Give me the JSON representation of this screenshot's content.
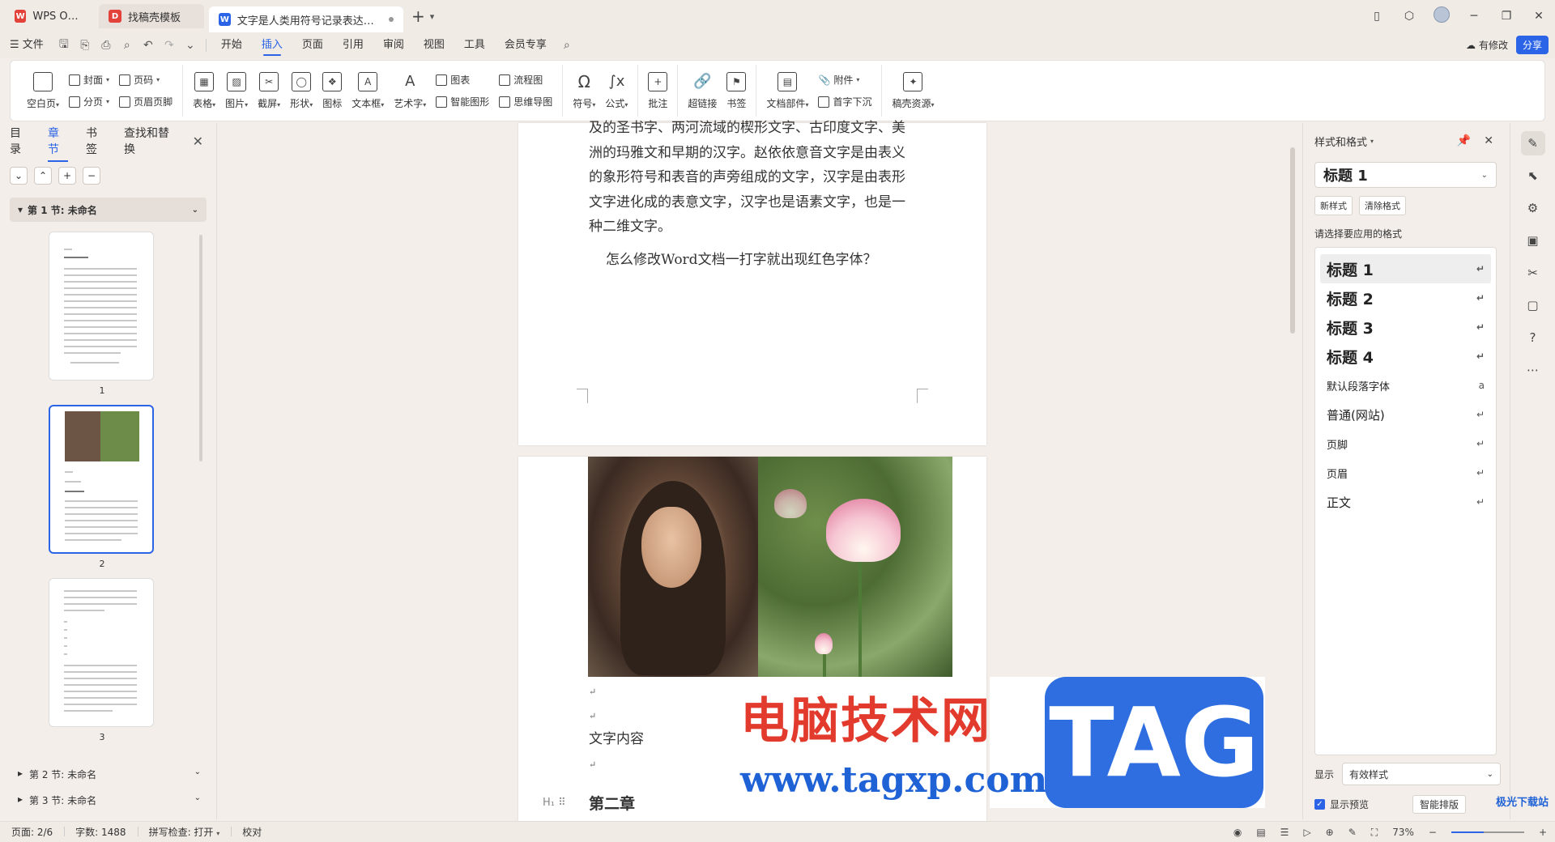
{
  "tabs": [
    {
      "label": "WPS Office",
      "logo": "W",
      "color": "#e3423a"
    },
    {
      "label": "找稿壳模板",
      "logo": "D",
      "color": "#e3423a"
    },
    {
      "label": "文字是人类用符号记录表达信息以",
      "logo": "W",
      "color": "#2b64e6"
    }
  ],
  "menu": {
    "file": "文件",
    "items": [
      "开始",
      "插入",
      "页面",
      "引用",
      "审阅",
      "视图",
      "工具",
      "会员专享"
    ],
    "active": "插入",
    "has_changes": "有修改",
    "share": "分享"
  },
  "ribbon": {
    "blank_page": "空白页",
    "cover": "封面",
    "page_break": "分页",
    "page_num": "页码",
    "header_footer": "页眉页脚",
    "table": "表格",
    "picture": "图片",
    "screenshot": "截屏",
    "shape": "形状",
    "icon": "图标",
    "textbox": "文本框",
    "wordart": "艺术字",
    "chart": "图表",
    "smartart": "智能图形",
    "flowchart": "流程图",
    "mindmap": "思维导图",
    "symbol": "符号",
    "formula": "公式",
    "comment": "批注",
    "hyperlink": "超链接",
    "bookmark": "书签",
    "doc_parts": "文档部件",
    "attachment": "附件",
    "dropcap": "首字下沉",
    "resources": "稿壳资源"
  },
  "nav": {
    "tabs": [
      "目录",
      "章节",
      "书签",
      "查找和替换"
    ],
    "active": "章节",
    "section1": "第 1 节: 未命名",
    "section2": "第 2 节: 未命名",
    "section3": "第 3 节: 未命名",
    "pages": [
      "1",
      "2",
      "3"
    ]
  },
  "document": {
    "para1": [
      "及的圣书字、两河流域的楔形文字、古印度文字、美",
      "洲的玛雅文和早期的汉字。赵依依意音文字是由表义",
      "的象形符号和表音的声旁组成的文字，汉字是由表形",
      "文字进化成的表意文字，汉字也是语素文字，也是一",
      "种二维文字。"
    ],
    "question": "怎么修改Word文档一打字就出现红色字体？",
    "content_label": "文字内容",
    "chapter2": "第二章",
    "para_mark": "↵"
  },
  "watermark": {
    "site_cn": "电脑技术网",
    "url": "www.tagxp.com",
    "tag": "TAG"
  },
  "styles_panel": {
    "title": "样式和格式",
    "current": "标题 1",
    "new_style": "新样式",
    "clear_format": "清除格式",
    "prompt": "请选择要应用的格式",
    "items": [
      "标题 1",
      "标题 2",
      "标题 3",
      "标题 4",
      "默认段落字体",
      "普通(网站)",
      "页脚",
      "页眉",
      "正文"
    ],
    "show_label": "显示",
    "show_value": "有效样式",
    "preview": "显示预览",
    "smart_layout": "智能排版"
  },
  "status": {
    "page": "页面: 2/6",
    "words": "字数: 1488",
    "spell": "拼写检查: 打开",
    "proof": "校对",
    "zoom": "73%"
  },
  "corner_badge": "极光下载站"
}
